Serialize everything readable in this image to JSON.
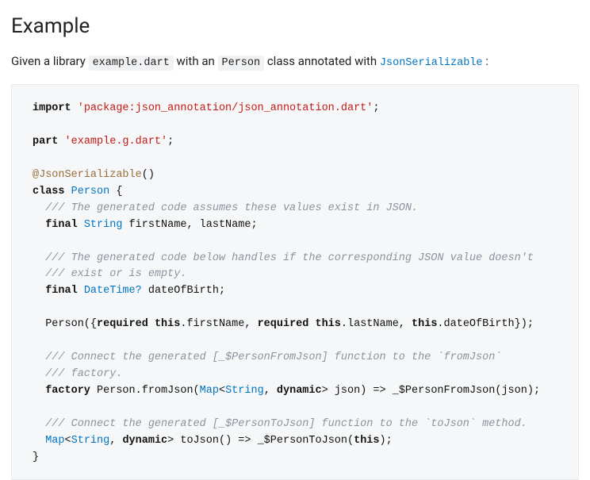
{
  "heading": "Example",
  "intro": {
    "t1": "Given a library ",
    "code1": "example.dart",
    "t2": " with an ",
    "code2": "Person",
    "t3": " class annotated with ",
    "link": "JsonSerializable",
    "t4": " :"
  },
  "code": {
    "kw_import": "import",
    "str_import": "'package:json_annotation/json_annotation.dart'",
    "semi": ";",
    "kw_part": "part",
    "str_part": "'example.g.dart'",
    "ann_js": "@JsonSerializable",
    "ann_paren": "()",
    "kw_class": "class",
    "type_person": "Person",
    "brace_open": " {",
    "cmt1": "/// The generated code assumes these values exist in JSON.",
    "kw_final": "final",
    "type_string": "String",
    "fields1": " firstName, lastName;",
    "cmt2a": "/// The generated code below handles if the corresponding JSON value doesn't",
    "cmt2b": "/// exist or is empty.",
    "type_datetime": "DateTime?",
    "field2": " dateOfBirth;",
    "ctor_a": "Person({",
    "kw_required": "required",
    "kw_this": "this",
    "ctor_fn": ".firstName, ",
    "ctor_ln": ".lastName, ",
    "ctor_dob": ".dateOfBirth});",
    "cmt3a": "/// Connect the generated [_$PersonFromJson] function to the `fromJson`",
    "cmt3b": "/// factory.",
    "kw_factory": "factory",
    "fj_a": " Person.fromJson(",
    "type_map": "Map",
    "lt": "<",
    "comma_sp": ", ",
    "kw_dynamic": "dynamic",
    "gt_json": "> json) => _$PersonFromJson(json);",
    "cmt4": "/// Connect the generated [_$PersonToJson] function to the `toJson` method.",
    "tj_a": "> toJson() => _$PersonToJson(",
    "tj_b": ");",
    "brace_close": "}"
  }
}
